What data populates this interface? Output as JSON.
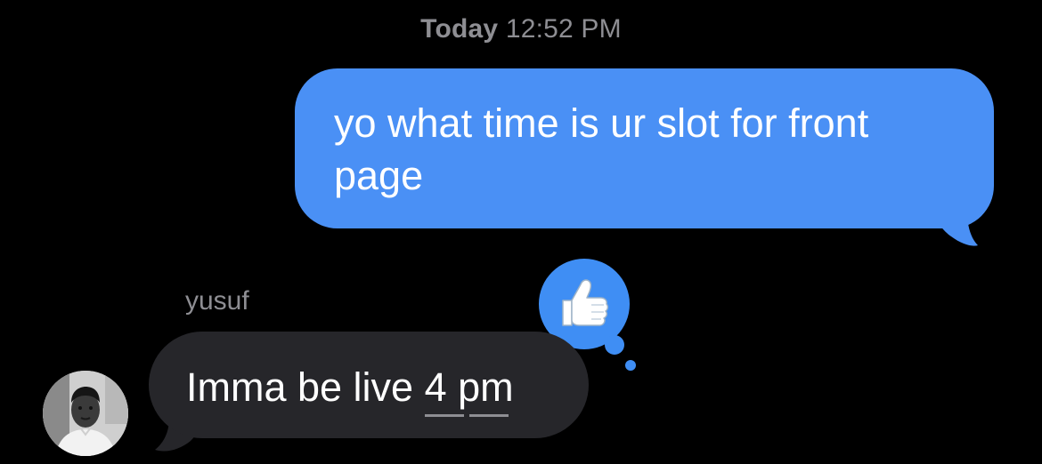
{
  "conversation": {
    "timestamp_day": "Today",
    "timestamp_time": "12:52 PM"
  },
  "messages": [
    {
      "direction": "sent",
      "text": "yo what time is ur slot for front page",
      "bubble_color": "#4a90f5",
      "reaction": {
        "type": "thumbs-up",
        "icon": "thumbs-up-icon",
        "bubble_color": "#3f8ef4"
      }
    },
    {
      "direction": "received",
      "sender": "yusuf",
      "text_before_link": "Imma be live ",
      "link_text": "4 pm",
      "bubble_color": "#26262a"
    }
  ],
  "colors": {
    "background": "#000000",
    "meta_text": "#8e8e93",
    "sent_bubble": "#4a90f5",
    "received_bubble": "#26262a"
  }
}
